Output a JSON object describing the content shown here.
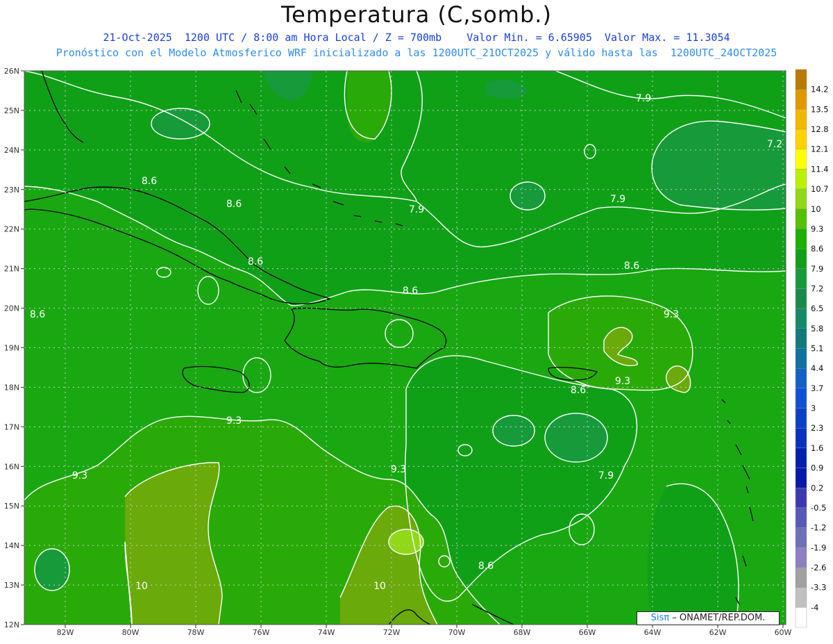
{
  "header": {
    "title": "Temperatura (C,somb.)",
    "line1": "21-Oct-2025  1200 UTC / 8:00 am Hora Local / Z = 700mb    Valor Min. = 6.65905  Valor Max. = 11.3054",
    "line2": "Pronóstico con el Modelo Atmosferico WRF inicializado a las 1200UTC_21OCT2025 y válido hasta las  1200UTC_24OCT2025"
  },
  "axes": {
    "lat_labels": [
      "26N",
      "25N",
      "24N",
      "23N",
      "22N",
      "21N",
      "20N",
      "19N",
      "18N",
      "17N",
      "16N",
      "15N",
      "14N",
      "13N",
      "12N"
    ],
    "lon_labels": [
      "82W",
      "80W",
      "78W",
      "76W",
      "74W",
      "72W",
      "70W",
      "68W",
      "66W",
      "64W",
      "62W",
      "60W"
    ]
  },
  "contour_labels": [
    {
      "text": "8.6"
    },
    {
      "text": "8.6"
    },
    {
      "text": "8.6"
    },
    {
      "text": "8.6"
    },
    {
      "text": "8.6"
    },
    {
      "text": "7.9"
    },
    {
      "text": "7.9"
    },
    {
      "text": "7.9"
    },
    {
      "text": "7.2"
    },
    {
      "text": "8.6"
    },
    {
      "text": "9.3"
    },
    {
      "text": "9.3"
    },
    {
      "text": "8.6"
    },
    {
      "text": "9.3"
    },
    {
      "text": "9.3"
    },
    {
      "text": "9.3"
    },
    {
      "text": "7.9"
    },
    {
      "text": "10"
    },
    {
      "text": "10"
    },
    {
      "text": "8.6"
    }
  ],
  "colorbar": {
    "labels": [
      "14.2",
      "13.5",
      "12.8",
      "12.1",
      "11.4",
      "10.7",
      "10",
      "9.3",
      "8.6",
      "7.9",
      "7.2",
      "6.5",
      "5.8",
      "5.1",
      "4.4",
      "3.7",
      "3",
      "2.3",
      "1.6",
      "0.9",
      "0.2",
      "-0.5",
      "-1.2",
      "-1.9",
      "-2.6",
      "-3.3",
      "-4"
    ],
    "colors": [
      "#b87a00",
      "#e09800",
      "#f0b800",
      "#ffd200",
      "#ffff00",
      "#b8f000",
      "#90d818",
      "#55c000",
      "#19b000",
      "#10a018",
      "#169a3a",
      "#1a8a4c",
      "#158a66",
      "#127a78",
      "#1070a0",
      "#1060c8",
      "#1050d8",
      "#0a40c8",
      "#0a30c0",
      "#0020b0",
      "#0818a8",
      "#3a3ab0",
      "#5858b8",
      "#7070b8",
      "#8c80c0",
      "#a0a0a0",
      "#c0c0c0",
      "#ffffff"
    ]
  },
  "map_colors": {
    "c79": "#10a018",
    "c72": "#169a3a",
    "c65": "#1a8a4c",
    "c86": "#19a812",
    "c93": "#2aaa08",
    "c10": "#6aaa0a",
    "c107": "#90d818"
  },
  "credit": {
    "sis": "Sis",
    "pi": "π",
    "rest": "– ONAMET/REP.DOM."
  }
}
